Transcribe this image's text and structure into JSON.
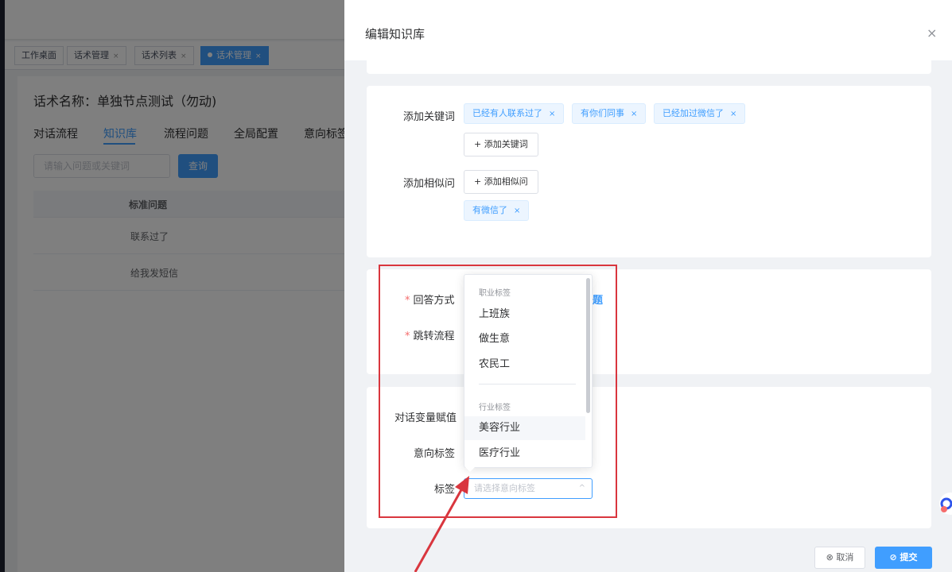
{
  "tags_view": [
    {
      "label": "工作桌面",
      "closable": false
    },
    {
      "label": "话术管理",
      "closable": true
    },
    {
      "label": "话术列表",
      "closable": true
    },
    {
      "label": "话术管理",
      "closable": true,
      "active": true
    }
  ],
  "tag_close_glyph": "×",
  "background_page": {
    "script_title": "话术名称：单独节点测试（勿动)",
    "tabs": [
      "对话流程",
      "知识库",
      "流程问题",
      "全局配置",
      "意向标签"
    ],
    "active_tab_index": 1,
    "search_placeholder": "请输入问题或关键词",
    "search_button": "查询",
    "table_header": "标准问题",
    "table_rows": [
      "联系过了",
      "给我发短信"
    ]
  },
  "drawer": {
    "title": "编辑知识库",
    "close_glyph": "×",
    "keywords_label": "添加关键词",
    "keywords": [
      "已经有人联系过了",
      "有你们同事",
      "已经加过微信了"
    ],
    "add_keyword_button": "+ 添加关键词",
    "similar_label": "添加相似问",
    "add_similar_button": "+ 添加相似问",
    "similar_questions": [
      "有微信了"
    ],
    "tag_remove_glyph": "×",
    "answer_mode_label": "回答方式",
    "jump_flow_label": "跳转流程",
    "required_mark": "*",
    "answer_mode_fragment": "题",
    "variable_label": "对话变量赋值",
    "intent_label": "意向标签",
    "tags_label": "标签",
    "tag_select_placeholder": "请选择意向标签",
    "select_arrow_glyph": "^",
    "dropdown": {
      "group_1": "职业标签",
      "group_1_items": [
        "上班族",
        "做生意",
        "农民工"
      ],
      "group_2": "行业标签",
      "group_2_items": [
        "美容行业",
        "医疗行业"
      ],
      "hovered_item": "美容行业"
    },
    "cancel_button": "⊗ 取消",
    "submit_button": "⊘ 提交"
  },
  "colors": {
    "primary": "#409eff",
    "annotation_red": "#d9363e",
    "required": "#f56c6c"
  },
  "icons": [
    "close-icon",
    "tag-remove-icon",
    "select-arrow-icon",
    "help-widget-icon",
    "annotation-arrow"
  ]
}
